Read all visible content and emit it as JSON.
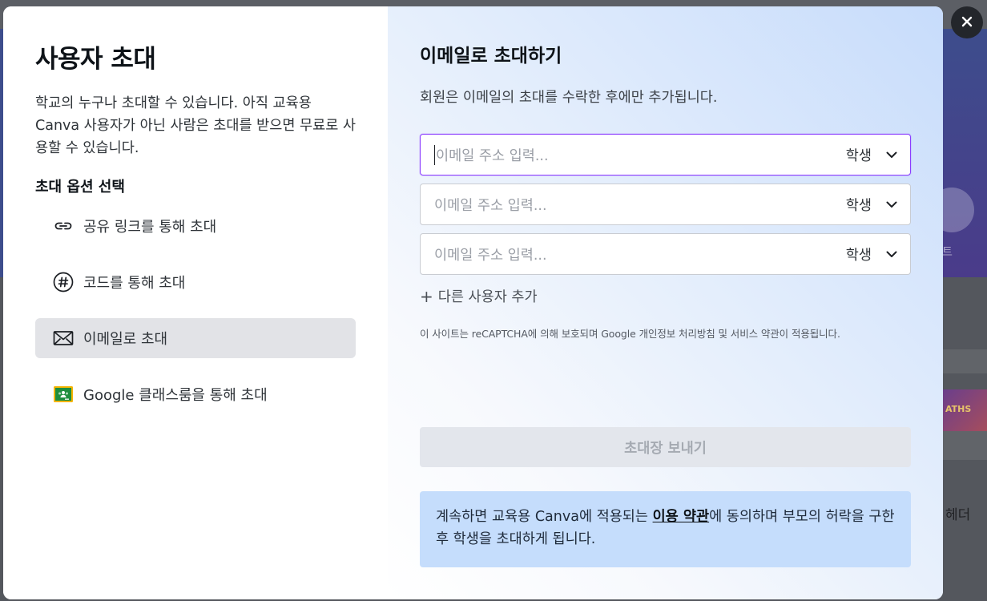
{
  "background": {
    "side_text": "트",
    "thumb_text": "ATHS",
    "header_text": "헤더"
  },
  "left": {
    "title": "사용자 초대",
    "description": "학교의 누구나 초대할 수 있습니다. 아직 교육용 Canva 사용자가 아닌 사람은 초대를 받으면 무료로 사용할 수 있습니다.",
    "options_title": "초대 옵션 선택",
    "options": [
      {
        "label": "공유 링크를 통해 초대",
        "icon": "link-icon",
        "active": false
      },
      {
        "label": "코드를 통해 초대",
        "icon": "hash-icon",
        "active": false
      },
      {
        "label": "이메일로 초대",
        "icon": "envelope-icon",
        "active": true
      },
      {
        "label": "Google 클래스룸을 통해 초대",
        "icon": "google-classroom-icon",
        "active": false
      }
    ]
  },
  "right": {
    "title": "이메일로 초대하기",
    "description": "회원은 이메일의 초대를 수락한 후에만 추가됩니다.",
    "fields": [
      {
        "placeholder": "이메일 주소 입력...",
        "value": "",
        "role": "학생"
      },
      {
        "placeholder": "이메일 주소 입력...",
        "value": "",
        "role": "학생"
      },
      {
        "placeholder": "이메일 주소 입력...",
        "value": "",
        "role": "학생"
      }
    ],
    "add_user_label": "다른 사용자 추가",
    "recaptcha_text": "이 사이트는 reCAPTCHA에 의해 보호되며 Google 개인정보 처리방침 및 서비스 약관이 적용됩니다.",
    "send_button": "초대장 보내기",
    "notice": {
      "before": "계속하면 교육용 Canva에 적용되는 ",
      "link": "이용 약관",
      "after": "에 동의하며 부모의 허락을 구한 후 학생을 초대하게 됩니다."
    }
  },
  "close_icon": "close-icon",
  "colors": {
    "focus_border": "#8b3dff",
    "notice_bg": "#c5ddfc",
    "active_option_bg": "#e2e3e7",
    "classroom_green": "#1e8e3e",
    "classroom_yellow": "#f4b400"
  }
}
